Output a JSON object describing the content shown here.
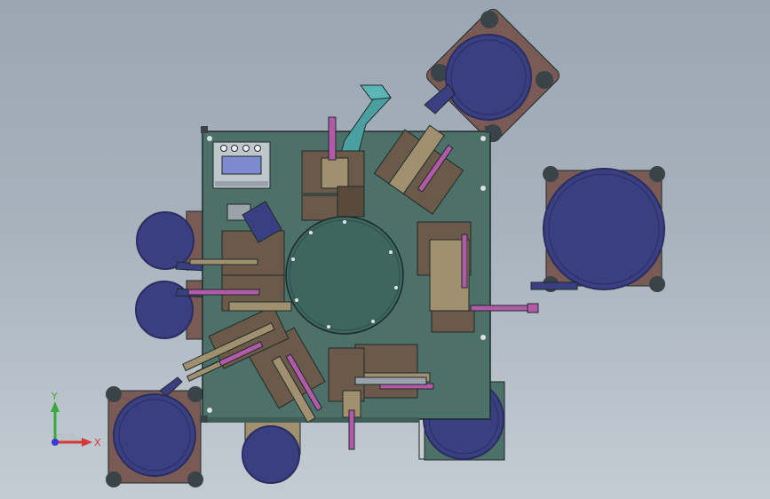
{
  "viewport": {
    "background_top": "#9aa6b2",
    "background_bottom": "#c4ccd3"
  },
  "colors": {
    "base_plate": "#4d7068",
    "base_plate_dark": "#3f5e57",
    "rotary_table": "#3d6660",
    "feeder_bowl": "#3a3f82",
    "feeder_bowl_rim": "#2a2d60",
    "feeder_base": "#7a5a54",
    "foot": "#3a4347",
    "mechanism_brown": "#6b5a49",
    "mechanism_tan": "#a09070",
    "actuator_magenta": "#b05aa8",
    "chute_teal": "#4aa0a0",
    "panel_gray": "#bfc6cc",
    "panel_screen": "#7d8ad0",
    "outline": "#1f2a2a"
  },
  "control_panel": {
    "icon": "control-panel-icon",
    "button_count": 4
  },
  "triad": {
    "x_label": "X",
    "y_label": "Y",
    "x_color": "#d43a3a",
    "y_color": "#3aa83a",
    "z_color": "#3a3ad4"
  }
}
